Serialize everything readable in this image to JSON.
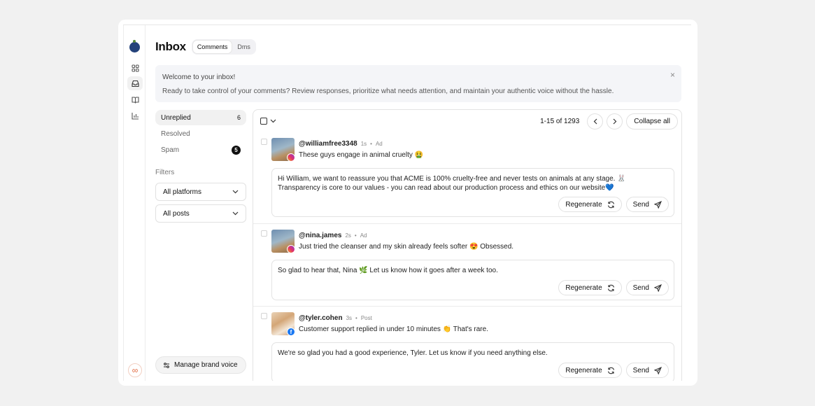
{
  "page": {
    "title": "Inbox",
    "tabs": [
      {
        "label": "Comments"
      },
      {
        "label": "Dms"
      }
    ]
  },
  "banner": {
    "heading": "Welcome to your inbox!",
    "body": "Ready to take control of your comments? Review responses, prioritize what needs attention, and maintain your authentic voice without the hassle.",
    "close": "×"
  },
  "sidebar": {
    "items": [
      {
        "label": "Unreplied",
        "count": "6"
      },
      {
        "label": "Resolved"
      },
      {
        "label": "Spam",
        "count": "5"
      }
    ],
    "filters_label": "Filters",
    "platform_select": "All platforms",
    "posts_select": "All posts",
    "brand_voice": "Manage brand voice"
  },
  "list": {
    "range": "1-15 of 1293",
    "collapse_label": "Collapse all",
    "items": [
      {
        "handle": "@williamfree3348",
        "time": "1s",
        "kind": "Ad",
        "platform": "instagram",
        "comment": "These guys engage in animal cruelty 🤮",
        "reply": "Hi William, we want to reassure you that ACME is 100% cruelty-free and never tests on animals at any stage. 🐰 Transparency is core to our values - you can read about our production process and ethics on our website💙"
      },
      {
        "handle": "@nina.james",
        "time": "2s",
        "kind": "Ad",
        "platform": "instagram",
        "comment": "Just tried the cleanser and my skin already feels softer 😍 Obsessed.",
        "reply": "So glad to hear that, Nina 🌿 Let us know how it goes after a week too."
      },
      {
        "handle": "@tyler.cohen",
        "time": "3s",
        "kind": "Post",
        "platform": "facebook",
        "comment": "Customer support replied in under 10 minutes 👏 That's rare.",
        "reply": "We're so glad you had a good experience, Tyler. Let us know if you need anything else."
      }
    ],
    "regenerate_label": "Regenerate",
    "send_label": "Send"
  }
}
